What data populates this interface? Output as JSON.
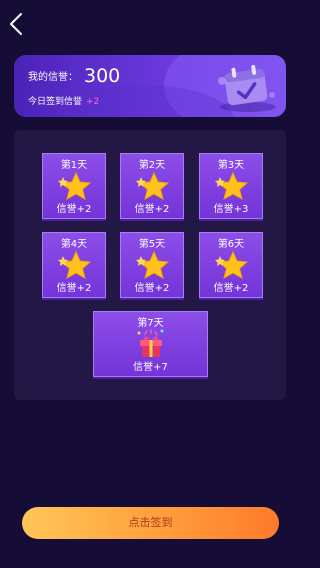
{
  "header": {
    "back_icon": "chevron-left-icon"
  },
  "credit": {
    "label": "我的信誉：",
    "score": "300",
    "today_label": "今日签到信誉",
    "today_bonus": "+2",
    "icon": "calendar-check-icon"
  },
  "days": [
    {
      "label": "第1天",
      "reward": "信誉+2",
      "icon": "star-icon"
    },
    {
      "label": "第2天",
      "reward": "信誉+2",
      "icon": "star-icon"
    },
    {
      "label": "第3天",
      "reward": "信誉+3",
      "icon": "star-icon"
    },
    {
      "label": "第4天",
      "reward": "信誉+2",
      "icon": "star-icon"
    },
    {
      "label": "第5天",
      "reward": "信誉+2",
      "icon": "star-icon"
    },
    {
      "label": "第6天",
      "reward": "信誉+2",
      "icon": "star-icon"
    },
    {
      "label": "第7天",
      "reward": "信誉+7",
      "icon": "gift-box-icon"
    }
  ],
  "checkin_button": {
    "label": "点击签到"
  },
  "colors": {
    "background": "#150d35",
    "card": "#7a3ddd",
    "accent_pink": "#ff6ad0",
    "button_start": "#ffc658",
    "button_end": "#ff7a2a"
  }
}
